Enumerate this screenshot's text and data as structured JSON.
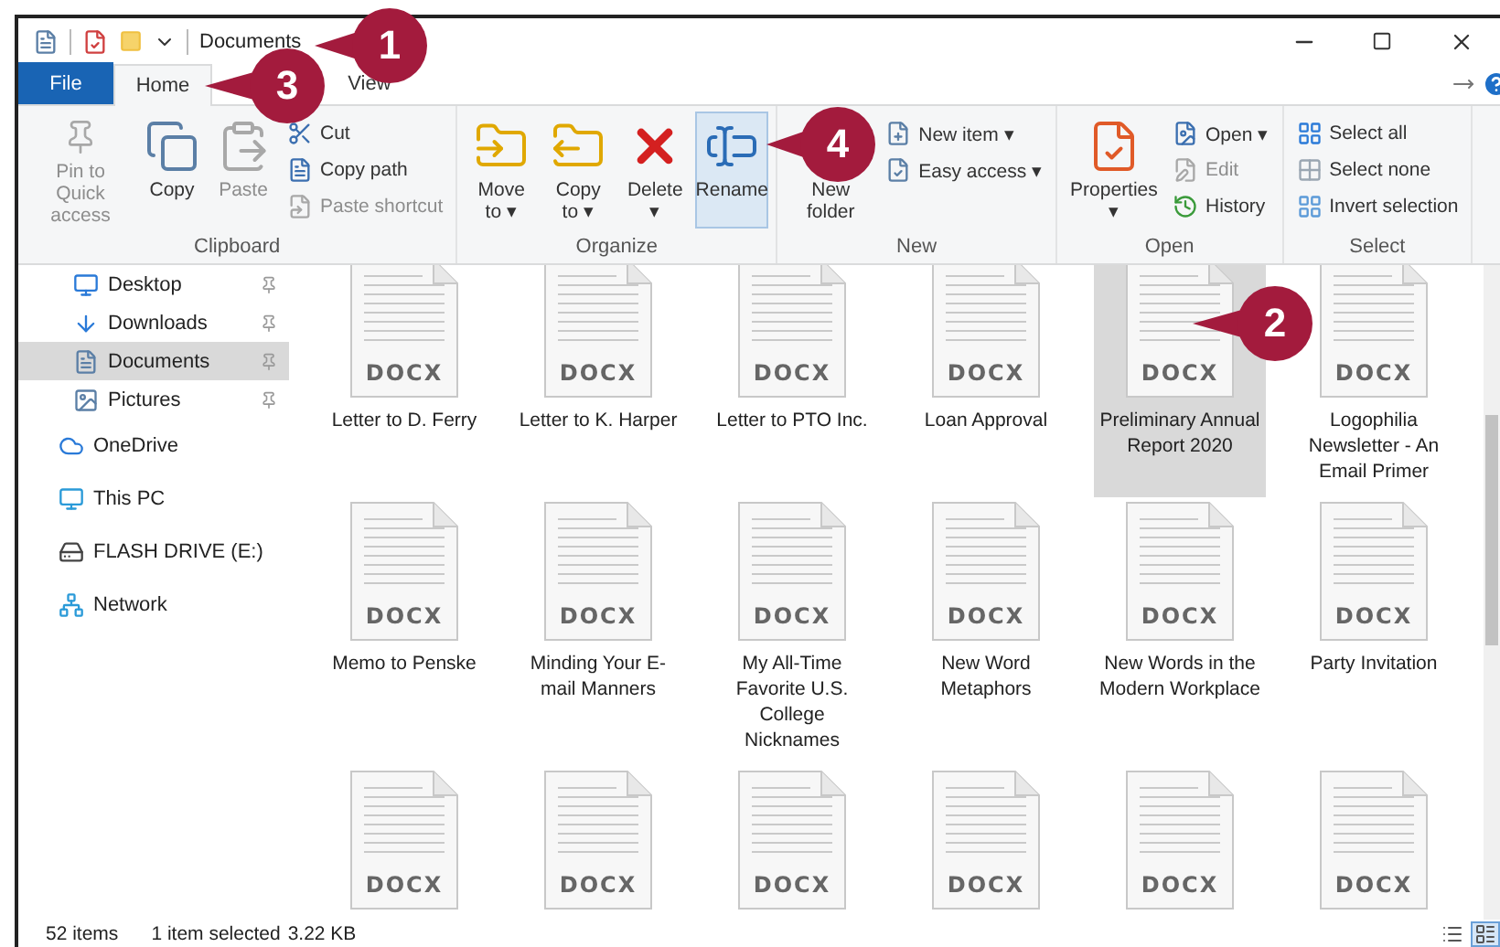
{
  "window": {
    "title": "Documents"
  },
  "tabs": [
    {
      "label": "File",
      "kind": "file",
      "selected": false
    },
    {
      "label": "Home",
      "kind": "tab",
      "selected": true
    },
    {
      "label": "View",
      "kind": "tab",
      "selected": false
    }
  ],
  "ribbon": {
    "groups": [
      {
        "label": "Clipboard",
        "buttons": [
          {
            "label": "Pin to Quick access",
            "kind": "large",
            "disabled": true
          },
          {
            "label": "Copy",
            "kind": "large",
            "disabled": false
          },
          {
            "label": "Paste",
            "kind": "large",
            "disabled": true
          },
          {
            "label": "Cut",
            "kind": "small",
            "disabled": false
          },
          {
            "label": "Copy path",
            "kind": "small",
            "disabled": false
          },
          {
            "label": "Paste shortcut",
            "kind": "small",
            "disabled": true
          }
        ]
      },
      {
        "label": "Organize",
        "buttons": [
          {
            "label": "Move to",
            "kind": "large",
            "disabled": false,
            "caret": "▾"
          },
          {
            "label": "Copy to",
            "kind": "large",
            "disabled": false,
            "caret": "▾"
          },
          {
            "label": "Delete",
            "kind": "large",
            "disabled": false,
            "caret": "▾"
          },
          {
            "label": "Rename",
            "kind": "large",
            "disabled": false,
            "highlighted": true
          }
        ]
      },
      {
        "label": "New",
        "buttons": [
          {
            "label": "New folder",
            "kind": "large",
            "disabled": false
          },
          {
            "label": "New item",
            "kind": "small",
            "disabled": false,
            "caret": "▾"
          },
          {
            "label": "Easy access",
            "kind": "small",
            "disabled": false,
            "caret": "▾"
          }
        ]
      },
      {
        "label": "Open",
        "buttons": [
          {
            "label": "Properties",
            "kind": "large",
            "disabled": false,
            "caret": "▾"
          },
          {
            "label": "Open",
            "kind": "small",
            "disabled": false,
            "caret": "▾"
          },
          {
            "label": "Edit",
            "kind": "small",
            "disabled": true
          },
          {
            "label": "History",
            "kind": "small",
            "disabled": false
          }
        ]
      },
      {
        "label": "Select",
        "buttons": [
          {
            "label": "Select all",
            "kind": "small",
            "disabled": false
          },
          {
            "label": "Select none",
            "kind": "small",
            "disabled": false
          },
          {
            "label": "Invert selection",
            "kind": "small",
            "disabled": false
          }
        ]
      }
    ]
  },
  "navigation": [
    {
      "label": "Desktop",
      "kind": "pinned",
      "selected": false
    },
    {
      "label": "Downloads",
      "kind": "pinned",
      "selected": false
    },
    {
      "label": "Documents",
      "kind": "pinned",
      "selected": true
    },
    {
      "label": "Pictures",
      "kind": "pinned",
      "selected": false
    },
    {
      "label": "OneDrive",
      "kind": "location",
      "selected": false
    },
    {
      "label": "This PC",
      "kind": "location",
      "selected": false
    },
    {
      "label": "FLASH DRIVE (E:)",
      "kind": "location",
      "selected": false
    },
    {
      "label": "Network",
      "kind": "location",
      "selected": false
    }
  ],
  "files": [
    {
      "type": "DOCX",
      "label": "Letter to D. Ferry",
      "selected": false
    },
    {
      "type": "DOCX",
      "label": "Letter to K. Harper",
      "selected": false
    },
    {
      "type": "DOCX",
      "label": "Letter to PTO Inc.",
      "selected": false
    },
    {
      "type": "DOCX",
      "label": "Loan Approval",
      "selected": false
    },
    {
      "type": "DOCX",
      "label": "Preliminary Annual Report 2020",
      "selected": true
    },
    {
      "type": "DOCX",
      "label": "Logophilia Newsletter - An Email Primer",
      "selected": false
    },
    {
      "type": "DOCX",
      "label": "Memo to Penske",
      "selected": false
    },
    {
      "type": "DOCX",
      "label": "Minding Your E-mail Manners",
      "selected": false
    },
    {
      "type": "DOCX",
      "label": "My All-Time Favorite U.S. College Nicknames",
      "selected": false
    },
    {
      "type": "DOCX",
      "label": "New Word Metaphors",
      "selected": false
    },
    {
      "type": "DOCX",
      "label": "New Words in the Modern Workplace",
      "selected": false
    },
    {
      "type": "DOCX",
      "label": "Party Invitation",
      "selected": false
    },
    {
      "type": "DOCX",
      "selected": false
    },
    {
      "type": "DOCX",
      "selected": false
    },
    {
      "type": "DOCX",
      "selected": false
    },
    {
      "type": "DOCX",
      "selected": false
    },
    {
      "type": "DOCX",
      "selected": false
    },
    {
      "type": "DOCX",
      "selected": false
    }
  ],
  "status_bar": {
    "item_count": "52 items",
    "selection": "1 item selected",
    "size": "3.22 KB",
    "views": [
      {
        "kind": "details",
        "selected": false
      },
      {
        "kind": "large-icons",
        "selected": true
      }
    ]
  },
  "callouts": [
    {
      "number": "1"
    },
    {
      "number": "3"
    },
    {
      "number": "4"
    },
    {
      "number": "2"
    }
  ]
}
